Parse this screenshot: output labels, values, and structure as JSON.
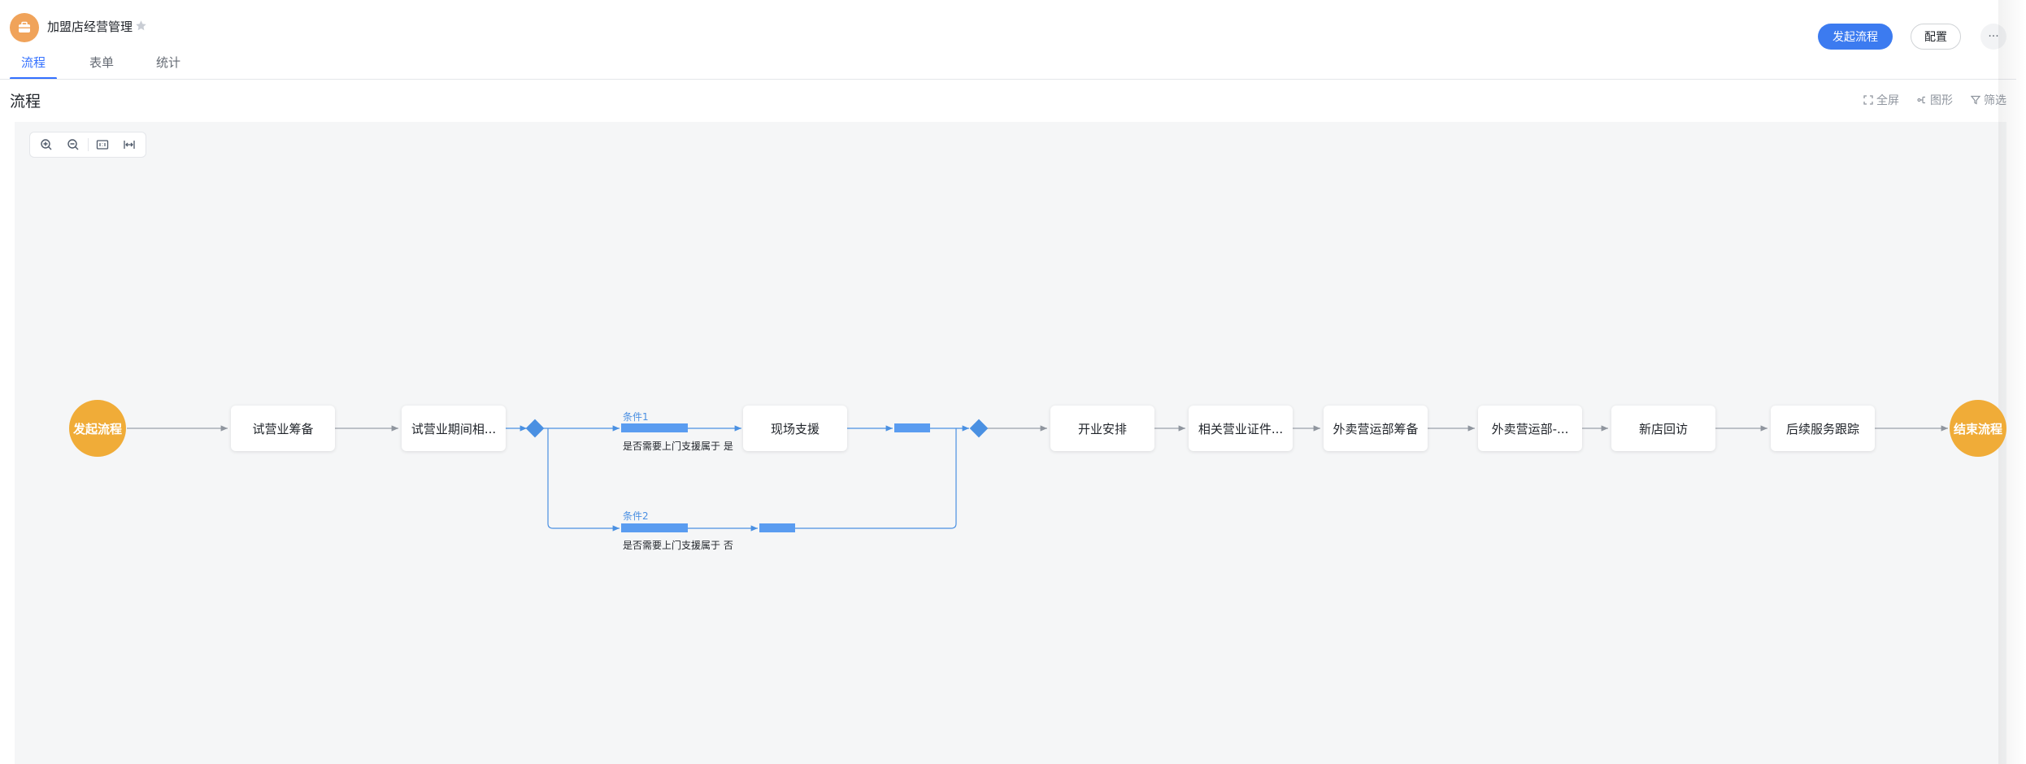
{
  "app": {
    "title": "加盟店经营管理"
  },
  "tabs": [
    {
      "label": "流程",
      "active": true
    },
    {
      "label": "表单",
      "active": false
    },
    {
      "label": "统计",
      "active": false
    }
  ],
  "header": {
    "start_label": "发起流程",
    "config_label": "配置",
    "more_label": "···"
  },
  "section": {
    "title": "流程",
    "fullscreen_label": "全屏",
    "graph_label": "图形",
    "filter_label": "筛选"
  },
  "flow": {
    "start_node": "发起流程",
    "end_node": "结束流程",
    "nodes": [
      "试营业筹备",
      "试营业期间相...",
      "现场支援",
      "开业安排",
      "相关营业证件...",
      "外卖营运部筹备",
      "外卖营运部-...",
      "新店回访",
      "后续服务跟踪"
    ],
    "branches": [
      {
        "label": "条件1",
        "condition": "是否需要上门支援属于 是"
      },
      {
        "label": "条件2",
        "condition": "是否需要上门支援属于 否"
      }
    ]
  },
  "colors": {
    "accent": "#3c7bf0",
    "start_end": "#f0ac38",
    "edge": "#4a90e2",
    "canvas": "#f5f6f7"
  }
}
